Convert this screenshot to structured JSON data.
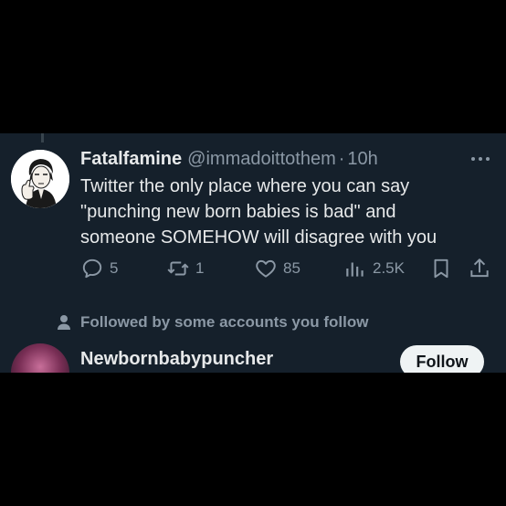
{
  "tweet": {
    "display_name": "Fatalfamine",
    "handle": "@immadoittothem",
    "separator": "·",
    "time": "10h",
    "text_lines": [
      "Twitter the only place where you can say",
      "\"punching new born babies is bad\" and",
      "someone SOMEHOW will disagree with you"
    ],
    "avatar_icon": "cartoon-avatar",
    "more_icon": "more-horizontal-icon"
  },
  "actions": {
    "reply": {
      "icon": "reply-icon",
      "count": "5"
    },
    "retweet": {
      "icon": "retweet-icon",
      "count": "1"
    },
    "like": {
      "icon": "heart-icon",
      "count": "85"
    },
    "views": {
      "icon": "views-icon",
      "count": "2.5K"
    },
    "bookmark": {
      "icon": "bookmark-icon"
    },
    "share": {
      "icon": "share-icon"
    }
  },
  "social_context": {
    "icon": "person-icon",
    "text": "Followed by some accounts you follow"
  },
  "suggested_user": {
    "name": "Newbornbabypuncher",
    "follow_label": "Follow"
  },
  "colors": {
    "panel_bg": "#15202b",
    "text_primary": "#e7e9ea",
    "text_secondary": "#8b98a5",
    "button_bg": "#eff3f4"
  }
}
